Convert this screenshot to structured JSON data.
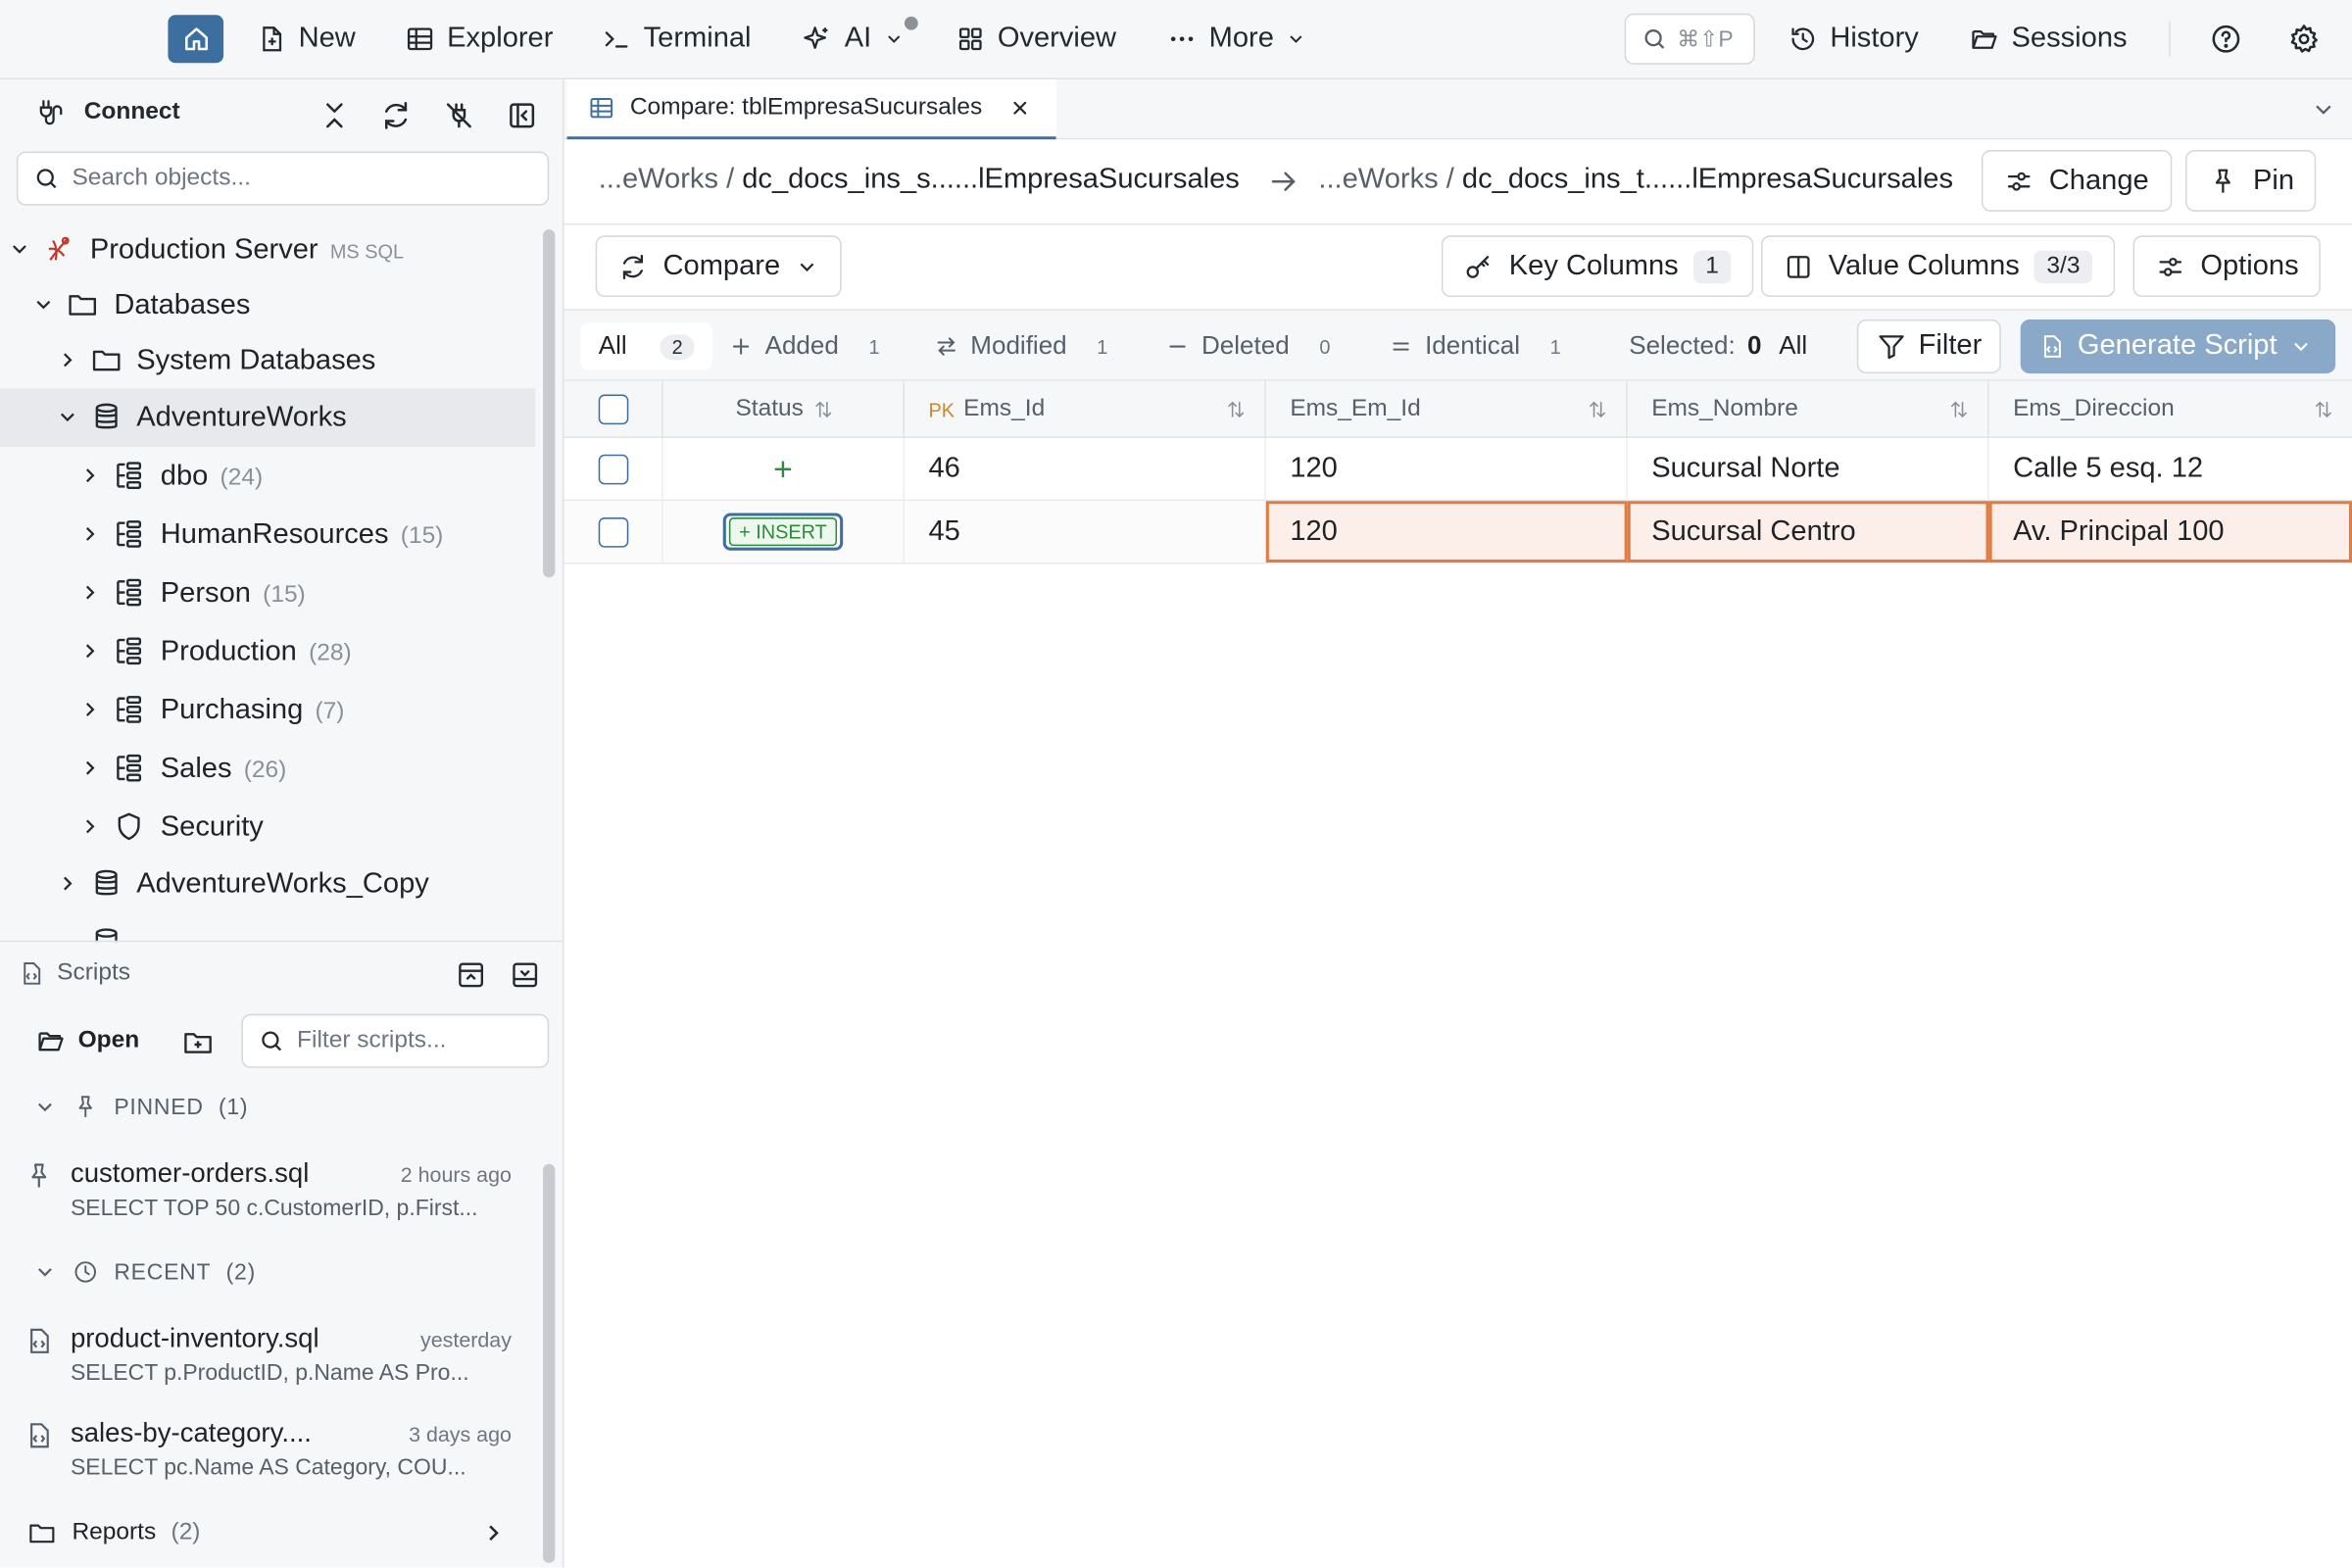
{
  "topbar": {
    "new": "New",
    "explorer": "Explorer",
    "terminal": "Terminal",
    "ai": "AI",
    "overview": "Overview",
    "more": "More",
    "search_shortcut": "⌘⇧P",
    "history": "History",
    "sessions": "Sessions"
  },
  "sidebar": {
    "title": "Connect",
    "search_placeholder": "Search objects...",
    "tree": {
      "server": "Production Server",
      "server_type": "MS SQL",
      "databases": "Databases",
      "system_databases": "System Databases",
      "adventureworks": "AdventureWorks",
      "schemas": [
        {
          "name": "dbo",
          "count": "(24)"
        },
        {
          "name": "HumanResources",
          "count": "(15)"
        },
        {
          "name": "Person",
          "count": "(15)"
        },
        {
          "name": "Production",
          "count": "(28)"
        },
        {
          "name": "Purchasing",
          "count": "(7)"
        },
        {
          "name": "Sales",
          "count": "(26)"
        }
      ],
      "security": "Security",
      "adventureworks_copy": "AdventureWorks_Copy"
    }
  },
  "scripts": {
    "title": "Scripts",
    "open": "Open",
    "filter_placeholder": "Filter scripts...",
    "pinned_label": "PINNED",
    "pinned_count": "(1)",
    "recent_label": "RECENT",
    "recent_count": "(2)",
    "pinned": [
      {
        "name": "customer-orders.sql",
        "time": "2 hours ago",
        "query": "SELECT TOP 50 c.CustomerID, p.First..."
      }
    ],
    "recent": [
      {
        "name": "product-inventory.sql",
        "time": "yesterday",
        "query": "SELECT p.ProductID, p.Name AS Pro..."
      },
      {
        "name": "sales-by-category....",
        "time": "3 days ago",
        "query": "SELECT pc.Name AS Category, COU..."
      }
    ],
    "reports_label": "Reports",
    "reports_count": "(2)"
  },
  "tab": {
    "label": "Compare: tblEmpresaSucursales"
  },
  "breadcrumb": {
    "source_prefix": "...eWorks /",
    "source_name": "dc_docs_ins_s......lEmpresaSucursales",
    "target_prefix": "...eWorks /",
    "target_name": "dc_docs_ins_t......lEmpresaSucursales",
    "change": "Change",
    "pin": "Pin"
  },
  "toolbar": {
    "compare": "Compare",
    "key_columns": "Key Columns",
    "key_columns_count": "1",
    "value_columns": "Value Columns",
    "value_columns_count": "3/3",
    "options": "Options"
  },
  "filters": {
    "all": "All",
    "all_count": "2",
    "added": "Added",
    "added_count": "1",
    "modified": "Modified",
    "modified_count": "1",
    "deleted": "Deleted",
    "deleted_count": "0",
    "identical": "Identical",
    "identical_count": "1",
    "selected_label": "Selected:",
    "selected_count": "0",
    "select_all": "All",
    "filter": "Filter",
    "generate_script": "Generate Script"
  },
  "grid": {
    "columns": [
      "Status",
      "Ems_Id",
      "Ems_Em_Id",
      "Ems_Nombre",
      "Ems_Direccion"
    ],
    "pk_label": "PK",
    "rows": [
      {
        "status": "+",
        "ems_id": "46",
        "ems_em_id": "120",
        "ems_nombre": "Sucursal Norte",
        "ems_direccion": "Calle 5 esq. 12"
      },
      {
        "status": "+ INSERT",
        "ems_id": "45",
        "ems_em_id": "120",
        "ems_nombre": "Sucursal Centro",
        "ems_direccion": "Av. Principal 100"
      }
    ]
  },
  "colors": {
    "accent": "#3c6fa0",
    "diff_border": "#e07b43",
    "diff_bg": "#fcefea",
    "added": "#2f8a3e"
  }
}
